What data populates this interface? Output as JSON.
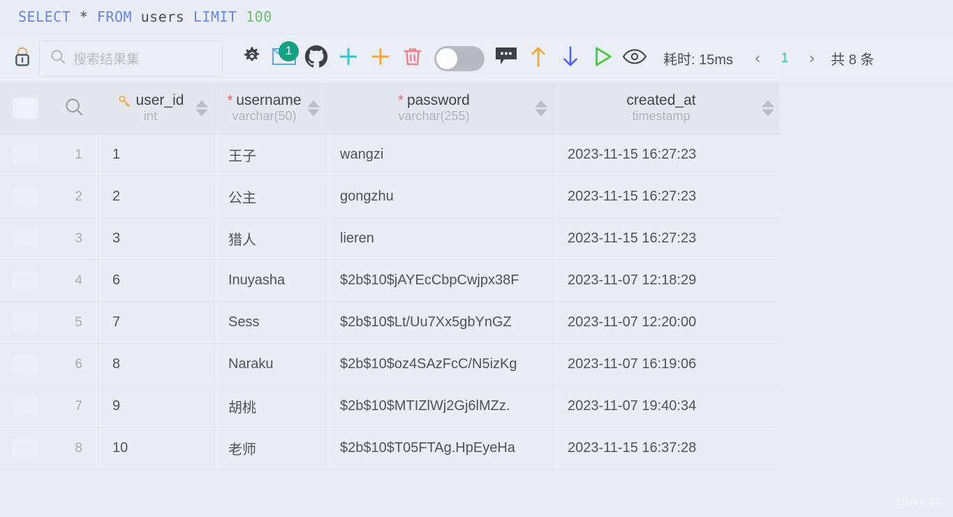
{
  "query": {
    "keyword1": "SELECT",
    "star": "*",
    "keyword2": "FROM",
    "table": "users",
    "keyword3": "LIMIT",
    "limit": "100"
  },
  "toolbar": {
    "lock_icon": "lock-icon",
    "search_placeholder": "搜索结果集",
    "search_value": "",
    "icons": [
      {
        "name": "settings-gear-icon",
        "label": "设置"
      },
      {
        "name": "mail-icon",
        "label": "消息",
        "badge": "1"
      },
      {
        "name": "github-icon",
        "label": "GitHub"
      },
      {
        "name": "add-row-icon",
        "label": "新增"
      },
      {
        "name": "add-column-icon",
        "label": "添加列"
      },
      {
        "name": "delete-icon",
        "label": "删除"
      },
      {
        "name": "toggle-switch",
        "label": "切换",
        "state": "off"
      },
      {
        "name": "comment-icon",
        "label": "备注"
      },
      {
        "name": "sort-asc-icon",
        "label": "升序"
      },
      {
        "name": "sort-desc-icon",
        "label": "降序"
      },
      {
        "name": "run-icon",
        "label": "执行"
      },
      {
        "name": "preview-eye-icon",
        "label": "预览"
      }
    ],
    "elapsed": "耗时: 15ms",
    "prev_arrow": "‹",
    "page": "1",
    "next_arrow": "›",
    "total": "共 8 条",
    "accent_color": "#2fbfa0"
  },
  "table": {
    "row_search_icon": "search-icon",
    "columns": [
      {
        "name": "user_id",
        "type": "int",
        "required": false,
        "primary_key": true
      },
      {
        "name": "username",
        "type": "varchar(50)",
        "required": true,
        "primary_key": false
      },
      {
        "name": "password",
        "type": "varchar(255)",
        "required": true,
        "primary_key": false
      },
      {
        "name": "created_at",
        "type": "timestamp",
        "required": false,
        "primary_key": false
      }
    ],
    "rows": [
      {
        "index": "1",
        "user_id": "1",
        "username": "王子",
        "password": "wangzi",
        "created_at": "2023-11-15 16:27:23"
      },
      {
        "index": "2",
        "user_id": "2",
        "username": "公主",
        "password": "gongzhu",
        "created_at": "2023-11-15 16:27:23"
      },
      {
        "index": "3",
        "user_id": "3",
        "username": "猎人",
        "password": "lieren",
        "created_at": "2023-11-15 16:27:23"
      },
      {
        "index": "4",
        "user_id": "6",
        "username": "Inuyasha",
        "password": "$2b$10$jAYEcCbpCwjpx38F",
        "created_at": "2023-11-07 12:18:29"
      },
      {
        "index": "5",
        "user_id": "7",
        "username": "Sess",
        "password": "$2b$10$Lt/Uu7Xx5gbYnGZ",
        "created_at": "2023-11-07 12:20:00"
      },
      {
        "index": "6",
        "user_id": "8",
        "username": "Naraku",
        "password": "$2b$10$oz4SAzFcC/N5izKg",
        "created_at": "2023-11-07 16:19:06"
      },
      {
        "index": "7",
        "user_id": "9",
        "username": "胡桃",
        "password": "$2b$10$MTIZlWj2Gj6lMZz.",
        "created_at": "2023-11-07 19:40:34"
      },
      {
        "index": "8",
        "user_id": "10",
        "username": "老师",
        "password": "$2b$10$T05FTAg.HpEyeHa",
        "created_at": "2023-11-15 16:37:28"
      }
    ]
  },
  "watermark": "znwx.cn"
}
